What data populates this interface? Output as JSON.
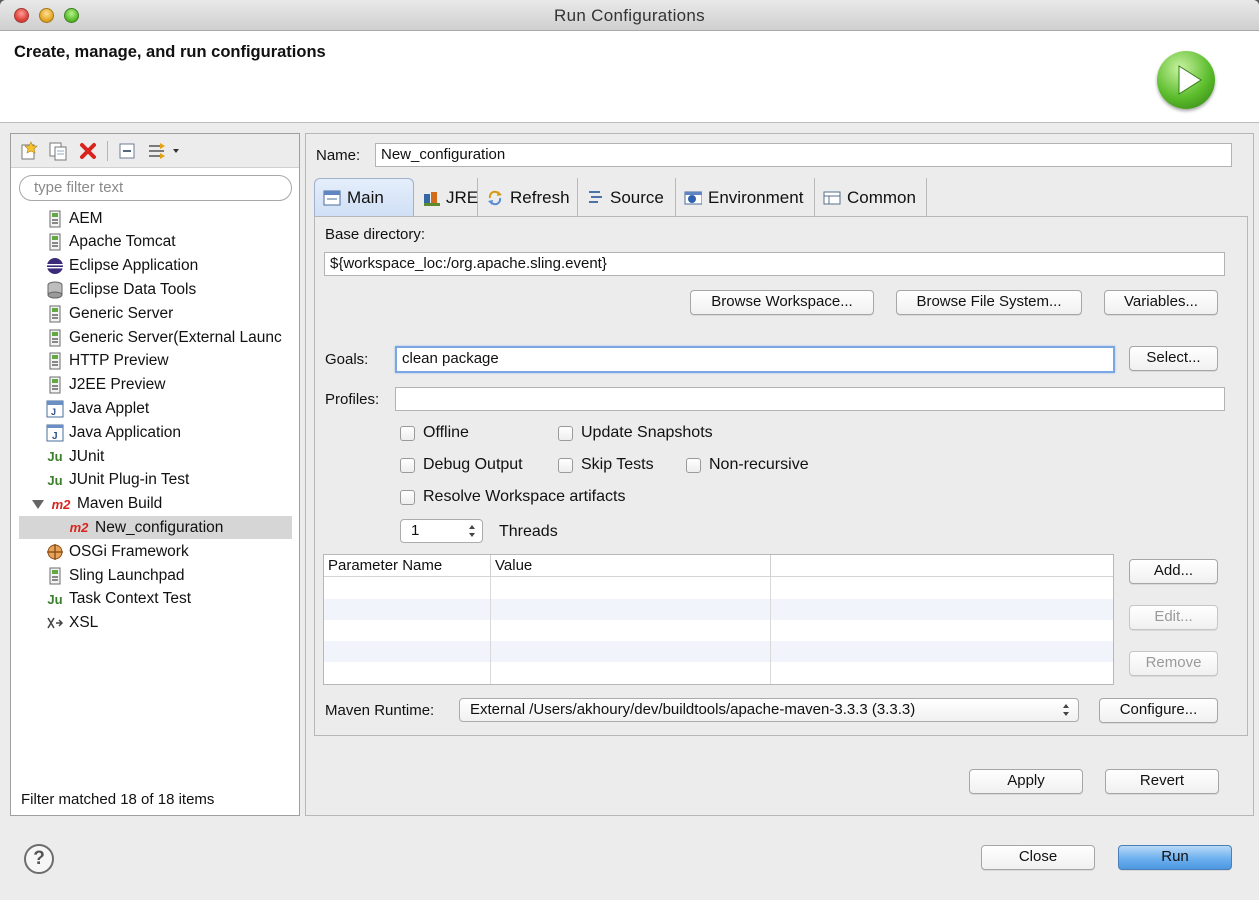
{
  "window": {
    "title": "Run Configurations"
  },
  "header": {
    "title": "Create, manage, and run configurations"
  },
  "left": {
    "filter_placeholder": "type filter text",
    "items": [
      {
        "label": "AEM",
        "icon": "launch-config-icon"
      },
      {
        "label": "Apache Tomcat",
        "icon": "launch-config-icon"
      },
      {
        "label": "Eclipse Application",
        "icon": "eclipse-icon"
      },
      {
        "label": "Eclipse Data Tools",
        "icon": "database-icon"
      },
      {
        "label": "Generic Server",
        "icon": "launch-config-icon"
      },
      {
        "label": "Generic Server(External Launc",
        "icon": "launch-config-icon"
      },
      {
        "label": "HTTP Preview",
        "icon": "launch-config-icon"
      },
      {
        "label": "J2EE Preview",
        "icon": "launch-config-icon"
      },
      {
        "label": "Java Applet",
        "icon": "java-applet-icon"
      },
      {
        "label": "Java Application",
        "icon": "java-app-icon"
      },
      {
        "label": "JUnit",
        "icon": "junit-icon"
      },
      {
        "label": "JUnit Plug-in Test",
        "icon": "junit-plugin-icon"
      },
      {
        "label": "Maven Build",
        "icon": "m2-icon"
      },
      {
        "label": "New_configuration",
        "icon": "m2-icon"
      },
      {
        "label": "OSGi Framework",
        "icon": "osgi-icon"
      },
      {
        "label": "Sling Launchpad",
        "icon": "launch-config-icon"
      },
      {
        "label": "Task Context Test",
        "icon": "junit-icon"
      },
      {
        "label": "XSL",
        "icon": "xsl-icon"
      }
    ],
    "m2_badge": "m2",
    "ju_badge": "Ju",
    "filter_status": "Filter matched 18 of 18 items"
  },
  "form": {
    "name_label": "Name:",
    "name_value": "New_configuration",
    "tabs": [
      {
        "label": "Main",
        "icon": "main-tab-icon"
      },
      {
        "label": "JRE",
        "icon": "jre-icon"
      },
      {
        "label": "Refresh",
        "icon": "refresh-icon"
      },
      {
        "label": "Source",
        "icon": "source-icon"
      },
      {
        "label": "Environment",
        "icon": "environment-icon"
      },
      {
        "label": "Common",
        "icon": "common-icon"
      }
    ],
    "base_dir_label": "Base directory:",
    "base_dir_value": "${workspace_loc:/org.apache.sling.event}",
    "browse_workspace": "Browse Workspace...",
    "browse_fs": "Browse File System...",
    "variables": "Variables...",
    "goals_label": "Goals:",
    "goals_value": "clean package",
    "select": "Select...",
    "profiles_label": "Profiles:",
    "profiles_value": "",
    "checkboxes": {
      "offline": "Offline",
      "update_snapshots": "Update Snapshots",
      "debug_output": "Debug Output",
      "skip_tests": "Skip Tests",
      "non_recursive": "Non-recursive",
      "resolve_workspace": "Resolve Workspace artifacts"
    },
    "threads_value": "1",
    "threads_label": "Threads",
    "params_table": {
      "col_name": "Parameter Name",
      "col_value": "Value"
    },
    "add": "Add...",
    "edit": "Edit...",
    "remove": "Remove",
    "runtime_label": "Maven Runtime:",
    "runtime_value": "External /Users/akhoury/dev/buildtools/apache-maven-3.3.3 (3.3.3)",
    "configure": "Configure...",
    "apply": "Apply",
    "revert": "Revert"
  },
  "footer": {
    "help": "?",
    "close": "Close",
    "run": "Run"
  },
  "colors": {
    "accent": "#6cb0ef",
    "selection": "#d6d6d6",
    "error_red": "#d9241d"
  }
}
